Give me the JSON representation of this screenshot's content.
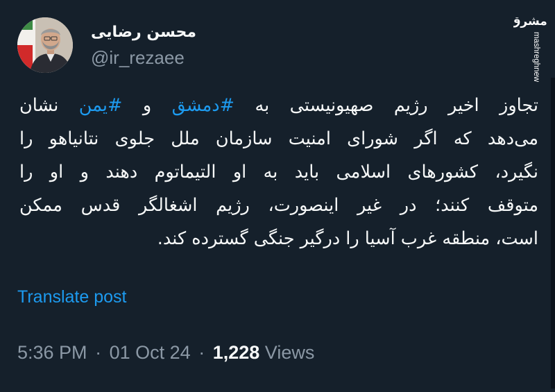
{
  "author": {
    "display_name": "محسن رضایی",
    "handle": "@ir_rezaee",
    "avatar": "avatar-photo"
  },
  "watermark": {
    "logo_text": "مشرق",
    "site": "mashreghnews.ir"
  },
  "tweet": {
    "lines": [
      {
        "before": "تجاوز اخیر رژیم صهیونیستی به ",
        "tag1": "#دمشق",
        "middle": " و ",
        "tag2": "#یمن",
        "after": " نشان"
      },
      {
        "text": "می‌دهد که اگر شورای امنیت سازمان ملل جلوی نتانیاهو را"
      },
      {
        "text": "نگیرد، کشورهای اسلامی باید به او التیماتوم دهند و او را"
      },
      {
        "text": "متوقف کنند؛ در غیر اینصورت، رژیم اشغالگر قدس ممکن"
      },
      {
        "text": "است، منطقه غرب آسیا را درگیر جنگی گسترده کند."
      }
    ]
  },
  "translate_label": "Translate post",
  "meta": {
    "time": "5:36 PM",
    "separator": "·",
    "date": "01 Oct 24",
    "views_count": "1,228",
    "views_label": "Views"
  },
  "colors": {
    "background": "#15202b",
    "text": "#f7f9f9",
    "secondary": "#8b98a5",
    "link": "#1d9bf0"
  }
}
